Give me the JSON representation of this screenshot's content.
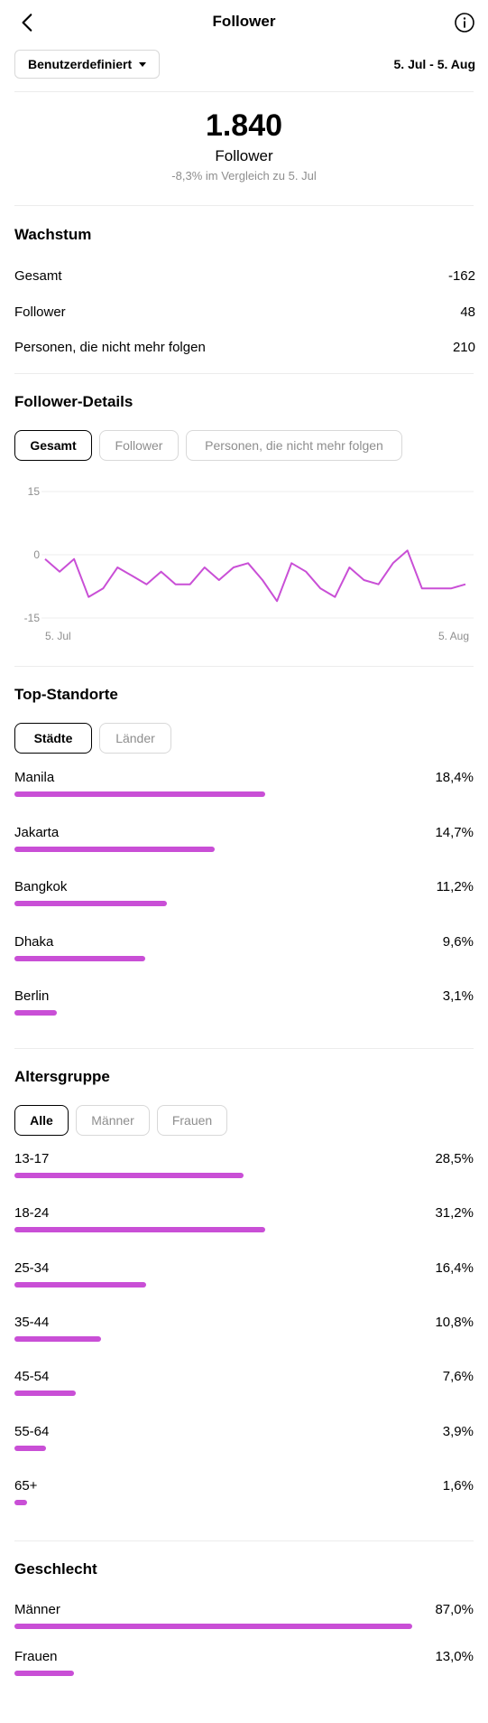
{
  "header": {
    "title": "Follower",
    "back_icon": "chevron-left-icon",
    "info_icon": "info-icon"
  },
  "filter": {
    "dropdown_label": "Benutzerdefiniert",
    "date_range": "5. Jul - 5. Aug"
  },
  "summary": {
    "total": "1.840",
    "label": "Follower",
    "compare": "-8,3% im Vergleich zu 5. Jul"
  },
  "growth": {
    "title": "Wachstum",
    "rows": [
      {
        "label": "Gesamt",
        "value": "-162"
      },
      {
        "label": "Follower",
        "value": "48"
      },
      {
        "label": "Personen, die nicht mehr folgen",
        "value": "210"
      }
    ]
  },
  "details": {
    "title": "Follower-Details",
    "tabs": [
      {
        "label": "Gesamt",
        "active": true
      },
      {
        "label": "Follower",
        "active": false
      },
      {
        "label": "Personen, die nicht mehr folgen",
        "active": false
      }
    ]
  },
  "chart_data": {
    "type": "line",
    "title": "",
    "xlabel": "",
    "ylabel": "",
    "ylim": [
      -15,
      15
    ],
    "yticks": [
      "15",
      "0",
      "-15"
    ],
    "x_start_label": "5. Jul",
    "x_end_label": "5. Aug",
    "grid": true,
    "color": "#c94fd6",
    "series": [
      {
        "values": [
          -1,
          -4,
          -1,
          -10,
          -8,
          -3,
          -5,
          -7,
          -4,
          -7,
          -7,
          -3,
          -6,
          -3,
          -2,
          -6,
          -11,
          -2,
          -4,
          -8,
          -10,
          -3,
          -6,
          -7,
          -2,
          1,
          -8,
          -8,
          -8,
          -7
        ]
      }
    ]
  },
  "locations": {
    "title": "Top-Standorte",
    "tabs": [
      {
        "label": "Städte",
        "active": true
      },
      {
        "label": "Länder",
        "active": false
      }
    ],
    "items": [
      {
        "label": "Manila",
        "pct": "18,4%",
        "value": 18.4
      },
      {
        "label": "Jakarta",
        "pct": "14,7%",
        "value": 14.7
      },
      {
        "label": "Bangkok",
        "pct": "11,2%",
        "value": 11.2
      },
      {
        "label": "Dhaka",
        "pct": "9,6%",
        "value": 9.6
      },
      {
        "label": "Berlin",
        "pct": "3,1%",
        "value": 3.1
      }
    ]
  },
  "age": {
    "title": "Altersgruppe",
    "tabs": [
      {
        "label": "Alle",
        "active": true
      },
      {
        "label": "Männer",
        "active": false
      },
      {
        "label": "Frauen",
        "active": false
      }
    ],
    "items": [
      {
        "label": "13-17",
        "pct": "28,5%",
        "value": 28.5
      },
      {
        "label": "18-24",
        "pct": "31,2%",
        "value": 31.2
      },
      {
        "label": "25-34",
        "pct": "16,4%",
        "value": 16.4
      },
      {
        "label": "35-44",
        "pct": "10,8%",
        "value": 10.8
      },
      {
        "label": "45-54",
        "pct": "7,6%",
        "value": 7.6
      },
      {
        "label": "55-64",
        "pct": "3,9%",
        "value": 3.9
      },
      {
        "label": "65+",
        "pct": "1,6%",
        "value": 1.6
      }
    ]
  },
  "gender": {
    "title": "Geschlecht",
    "items": [
      {
        "label": "Männer",
        "pct": "87,0%",
        "value": 87.0
      },
      {
        "label": "Frauen",
        "pct": "13,0%",
        "value": 13.0
      }
    ]
  }
}
